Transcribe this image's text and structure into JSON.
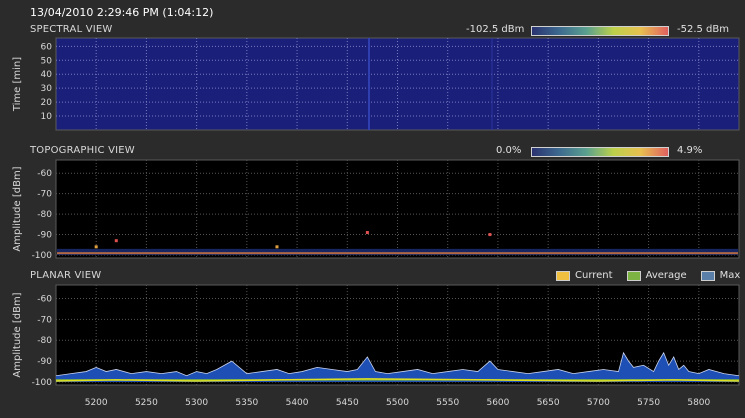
{
  "header": {
    "timestamp": "13/04/2010 2:29:46 PM (1:04:12)"
  },
  "colors": {
    "background": "#2b2b2b",
    "spectral_fill": "#1a1f7a",
    "current": "#e0e020",
    "average": "#7cb342",
    "max": "#1e4fb4"
  },
  "spectral": {
    "title": "SPECTRAL VIEW",
    "scale_min": "-102.5 dBm",
    "scale_max": "-52.5 dBm",
    "ylabel": "Time [min]",
    "yticks": [
      "60",
      "50",
      "40",
      "30",
      "20",
      "10"
    ]
  },
  "topographic": {
    "title": "TOPOGRAPHIC VIEW",
    "scale_min": "0.0%",
    "scale_max": "4.9%",
    "ylabel": "Amplitude [dBm]",
    "yticks": [
      "-60",
      "-70",
      "-80",
      "-90",
      "-100"
    ]
  },
  "planar": {
    "title": "PLANAR VIEW",
    "ylabel": "Amplitude [dBm]",
    "yticks": [
      "-60",
      "-70",
      "-80",
      "-90",
      "-100"
    ],
    "legend": [
      {
        "label": "Current",
        "color": "#f0c040"
      },
      {
        "label": "Average",
        "color": "#7cb342"
      },
      {
        "label": "Max",
        "color": "#5a7fa8"
      }
    ]
  },
  "chart_data": {
    "type": "area",
    "xlabel": "",
    "ylabel": "Amplitude [dBm]",
    "xlim": [
      5160,
      5840
    ],
    "ylim": [
      -100,
      -55
    ],
    "x_ticks": [
      5200,
      5250,
      5300,
      5350,
      5400,
      5450,
      5500,
      5550,
      5600,
      5650,
      5700,
      5750,
      5800
    ],
    "series": [
      {
        "name": "Max",
        "x": [
          5160,
          5175,
          5190,
          5200,
          5210,
          5220,
          5235,
          5250,
          5265,
          5280,
          5290,
          5300,
          5310,
          5320,
          5335,
          5350,
          5365,
          5380,
          5392,
          5405,
          5420,
          5435,
          5450,
          5460,
          5470,
          5478,
          5490,
          5505,
          5520,
          5535,
          5550,
          5565,
          5580,
          5592,
          5600,
          5615,
          5630,
          5645,
          5660,
          5675,
          5690,
          5705,
          5720,
          5725,
          5730,
          5735,
          5745,
          5755,
          5760,
          5765,
          5770,
          5775,
          5780,
          5785,
          5790,
          5800,
          5810,
          5825,
          5840
        ],
        "values": [
          -97,
          -96,
          -95,
          -93,
          -95,
          -94,
          -96,
          -95,
          -96,
          -95,
          -97,
          -95,
          -96,
          -94,
          -90,
          -96,
          -95,
          -94,
          -96,
          -95,
          -93,
          -94,
          -95,
          -94,
          -88,
          -95,
          -96,
          -95,
          -94,
          -96,
          -95,
          -94,
          -95,
          -90,
          -94,
          -95,
          -96,
          -95,
          -94,
          -96,
          -95,
          -94,
          -95,
          -86,
          -90,
          -93,
          -92,
          -95,
          -90,
          -86,
          -92,
          -88,
          -94,
          -92,
          -95,
          -96,
          -94,
          -96,
          -97
        ]
      },
      {
        "name": "Average",
        "x": [
          5160,
          5300,
          5450,
          5600,
          5750,
          5840
        ],
        "values": [
          -99,
          -99,
          -99,
          -99,
          -99,
          -99
        ]
      },
      {
        "name": "Current",
        "x": [
          5160,
          5220,
          5300,
          5380,
          5470,
          5592,
          5700,
          5775,
          5840
        ],
        "values": [
          -99.5,
          -99,
          -99.5,
          -99,
          -98.5,
          -99,
          -99.5,
          -99,
          -99.5
        ]
      }
    ]
  }
}
